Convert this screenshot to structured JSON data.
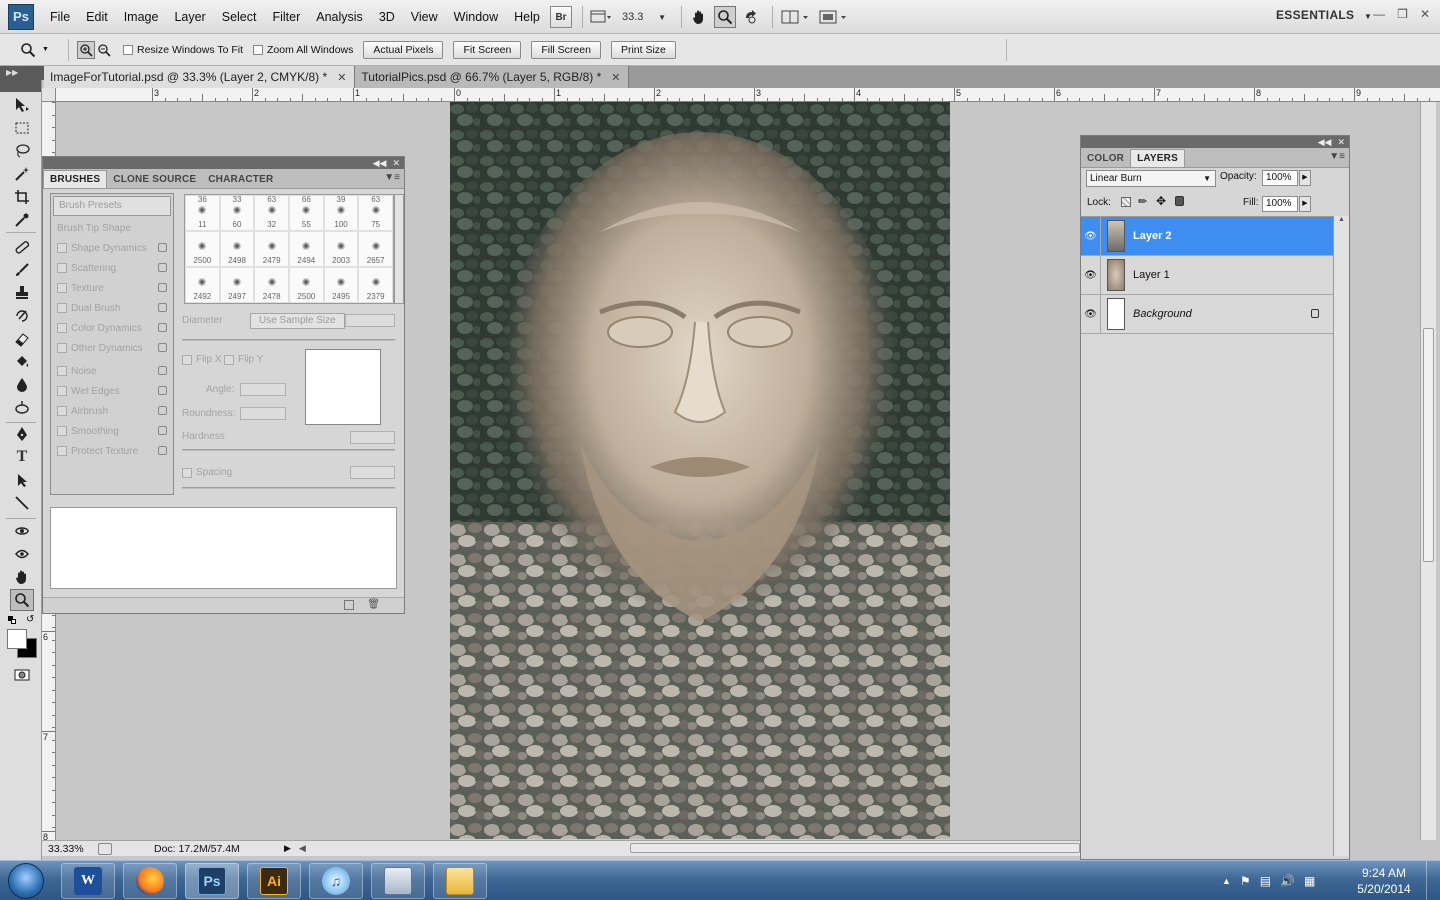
{
  "app": {
    "logo": "Ps",
    "menu": [
      "File",
      "Edit",
      "Image",
      "Layer",
      "Select",
      "Filter",
      "Analysis",
      "3D",
      "View",
      "Window",
      "Help"
    ],
    "bridge_label": "Br",
    "zoom_value": "33.3",
    "workspace": "ESSENTIALS"
  },
  "options": {
    "resize_windows": "Resize Windows To Fit",
    "zoom_all": "Zoom All Windows",
    "actual_pixels": "Actual Pixels",
    "fit_screen": "Fit Screen",
    "fill_screen": "Fill Screen",
    "print_size": "Print Size"
  },
  "documents": [
    {
      "title": "ImageForTutorial.psd @ 33.3% (Layer 2, CMYK/8) *",
      "active": true
    },
    {
      "title": "TutorialPics.psd @ 66.7% (Layer 5, RGB/8) *",
      "active": false
    }
  ],
  "rulers": {
    "h_labels": [
      "3",
      "2",
      "1",
      "0",
      "1",
      "2",
      "3",
      "4",
      "5",
      "6",
      "7",
      "8",
      "9"
    ],
    "v_labels": [
      "6",
      "7",
      "8"
    ]
  },
  "brushes_panel": {
    "tabs": [
      "BRUSHES",
      "CLONE SOURCE",
      "CHARACTER"
    ],
    "brush_presets": "Brush Presets",
    "brush_tip_shape": "Brush Tip Shape",
    "options": [
      "Shape Dynamics",
      "Scattering",
      "Texture",
      "Dual Brush",
      "Color Dynamics",
      "Other Dynamics",
      "Noise",
      "Wet Edges",
      "Airbrush",
      "Smoothing",
      "Protect Texture"
    ],
    "tip_top_row": [
      "36",
      "33",
      "63",
      "66",
      "39",
      "63"
    ],
    "tip_sizes": [
      "11",
      "60",
      "32",
      "55",
      "100",
      "75",
      "2500",
      "2498",
      "2479",
      "2494",
      "2003",
      "2657",
      "2492",
      "2497",
      "2478",
      "2500",
      "2495",
      "2379"
    ],
    "diameter": "Diameter",
    "use_sample_size": "Use Sample Size",
    "flip_x": "Flip X",
    "flip_y": "Flip Y",
    "angle": "Angle:",
    "roundness": "Roundness:",
    "hardness": "Hardness",
    "spacing": "Spacing"
  },
  "layers_panel": {
    "tabs": [
      "COLOR",
      "LAYERS"
    ],
    "blend_mode": "Linear Burn",
    "opacity_label": "Opacity:",
    "opacity": "100%",
    "lock_label": "Lock:",
    "fill_label": "Fill:",
    "fill": "100%",
    "layers": [
      {
        "name": "Layer 2",
        "selected": true
      },
      {
        "name": "Layer 1",
        "selected": false
      },
      {
        "name": "Background",
        "selected": false,
        "locked": true
      }
    ]
  },
  "status": {
    "zoom": "33.33%",
    "doc": "Doc: 17.2M/57.4M"
  },
  "taskbar": {
    "apps": [
      "W",
      "Firefox",
      "Ps",
      "Ai",
      "iTunes",
      "Calculator",
      "Explorer"
    ],
    "time": "9:24 AM",
    "date": "5/20/2014"
  }
}
